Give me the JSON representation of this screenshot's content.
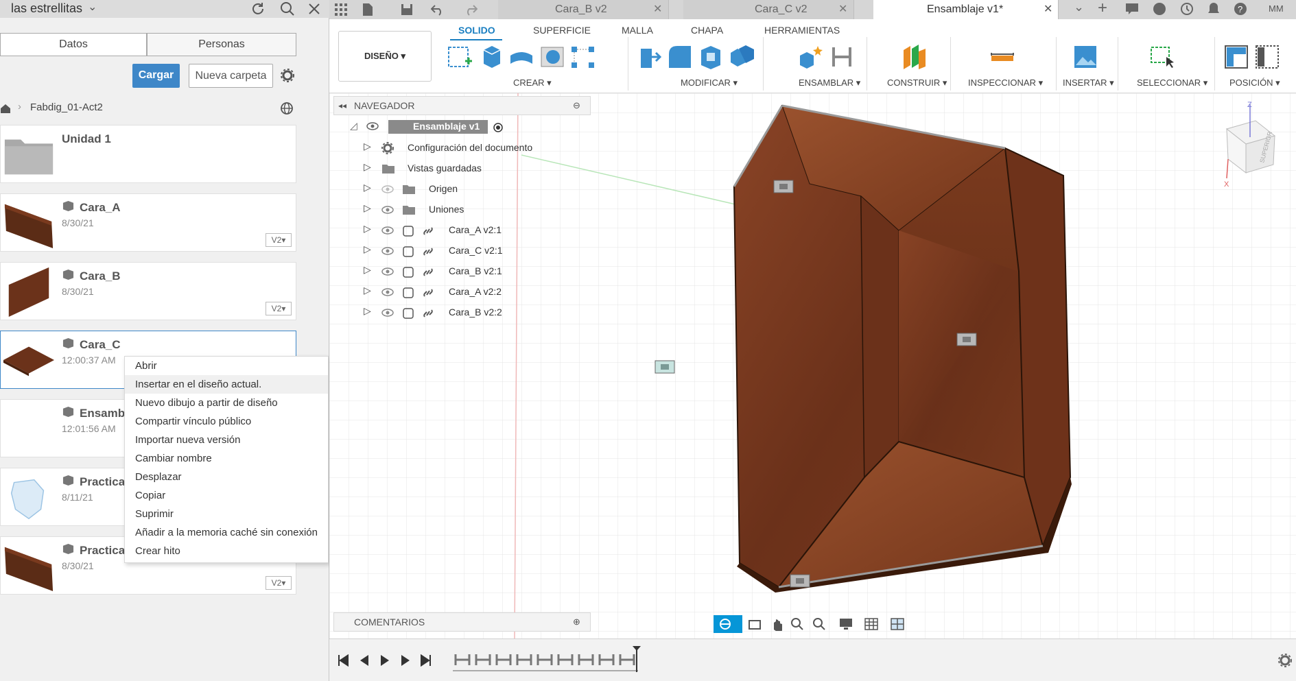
{
  "project": {
    "name": "las estrellitas"
  },
  "panel_tabs": {
    "data": "Datos",
    "people": "Personas"
  },
  "panel_buttons": {
    "upload": "Cargar",
    "new_folder": "Nueva carpeta"
  },
  "breadcrumb": {
    "folder": "Fabdig_01-Act2"
  },
  "files": [
    {
      "name": "Unidad 1",
      "date": "",
      "version": ""
    },
    {
      "name": "Cara_A",
      "date": "8/30/21",
      "version": "V2▾"
    },
    {
      "name": "Cara_B",
      "date": "8/30/21",
      "version": "V2▾"
    },
    {
      "name": "Cara_C",
      "date": "12:00:37 AM",
      "version": ""
    },
    {
      "name": "Ensambl",
      "date": "12:01:56 AM",
      "version": ""
    },
    {
      "name": "Practica",
      "date": "8/11/21",
      "version": ""
    },
    {
      "name": "Practica",
      "date": "8/30/21",
      "version": "V2▾"
    }
  ],
  "context_menu": [
    "Abrir",
    "Insertar en el diseño actual.",
    "Nuevo dibujo a partir de diseño",
    "Compartir vínculo público",
    "Importar nueva versión",
    "Cambiar nombre",
    "Desplazar",
    "Copiar",
    "Suprimir",
    "Añadir a la memoria caché sin conexión",
    "Crear hito"
  ],
  "doc_tabs": [
    {
      "label": "Cara_B v2"
    },
    {
      "label": "Cara_C v2"
    },
    {
      "label": "Ensamblaje v1*"
    }
  ],
  "user": {
    "initials": "MM"
  },
  "workspace": {
    "label": "DISEÑO ▾"
  },
  "toolbar_tabs": [
    "SOLIDO",
    "SUPERFICIE",
    "MALLA",
    "CHAPA",
    "HERRAMIENTAS"
  ],
  "toolbar_groups": [
    "CREAR ▾",
    "MODIFICAR ▾",
    "ENSAMBLAR ▾",
    "CONSTRUIR ▾",
    "INSPECCIONAR ▾",
    "INSERTAR ▾",
    "SELECCIONAR ▾",
    "POSICIÓN ▾"
  ],
  "browser": {
    "title": "NAVEGADOR",
    "root": "Ensamblaje v1",
    "items": [
      "Configuración del documento",
      "Vistas guardadas",
      "Origen",
      "Uniones",
      "Cara_A v2:1",
      "Cara_C v2:1",
      "Cara_B v2:1",
      "Cara_A v2:2",
      "Cara_B v2:2"
    ]
  },
  "comments": {
    "title": "COMENTARIOS"
  },
  "viewcube": {
    "face": "SUPERIOR",
    "axis_z": "Z",
    "axis_x": "X"
  },
  "colors": {
    "accent": "#0696d7",
    "upload_button": "#3e87c8",
    "wood": "#7a3a1e"
  }
}
